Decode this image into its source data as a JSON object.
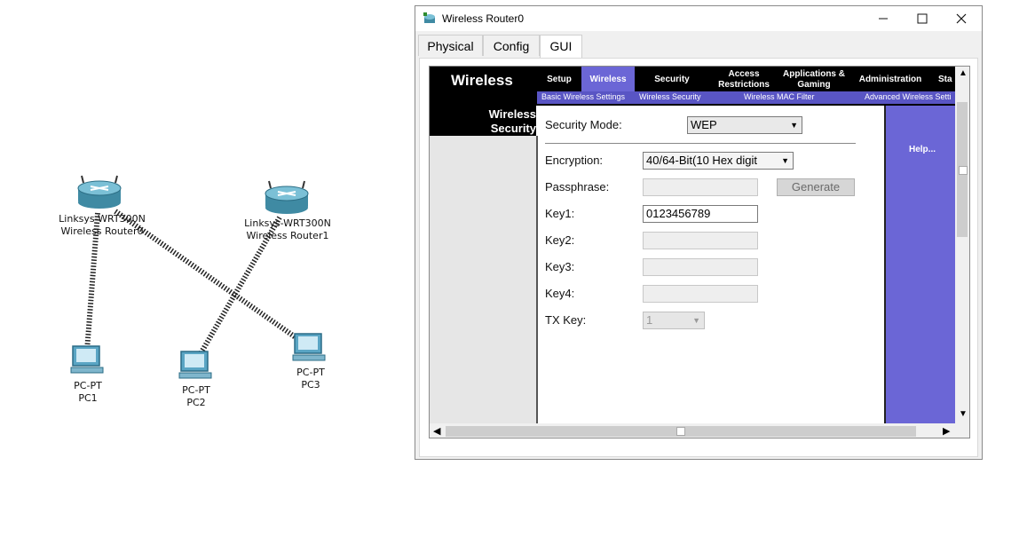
{
  "topology": {
    "routers": [
      {
        "model": "Linksys-WRT300N",
        "name": "Wireless Router0"
      },
      {
        "model": "Linksys-WRT300N",
        "name": "Wireless Router1"
      }
    ],
    "pcs": [
      {
        "model": "PC-PT",
        "name": "PC1"
      },
      {
        "model": "PC-PT",
        "name": "PC2"
      },
      {
        "model": "PC-PT",
        "name": "PC3"
      }
    ]
  },
  "window": {
    "title": "Wireless Router0",
    "tabs": [
      "Physical",
      "Config",
      "GUI"
    ],
    "active_tab": "GUI"
  },
  "router_gui": {
    "brand": "Wireless",
    "menu": [
      {
        "label": "Setup"
      },
      {
        "label": "Wireless",
        "active": true
      },
      {
        "label": "Security"
      },
      {
        "label": "Access Restrictions"
      },
      {
        "label": "Applications & Gaming"
      },
      {
        "label": "Administration"
      },
      {
        "label": "Sta"
      }
    ],
    "submenu": [
      "Basic Wireless Settings",
      "Wireless Security",
      "Wireless MAC Filter",
      "Advanced Wireless Setti"
    ],
    "section_title_line1": "Wireless",
    "section_title_line2": "Security",
    "help_label": "Help...",
    "security_mode_label": "Security Mode:",
    "security_mode_value": "WEP",
    "encryption_label": "Encryption:",
    "encryption_value": "40/64-Bit(10 Hex digit",
    "passphrase_label": "Passphrase:",
    "passphrase_value": "",
    "generate_label": "Generate",
    "key1_label": "Key1:",
    "key1_value": "0123456789",
    "key2_label": "Key2:",
    "key2_value": "",
    "key3_label": "Key3:",
    "key3_value": "",
    "key4_label": "Key4:",
    "key4_value": "",
    "txkey_label": "TX Key:",
    "txkey_value": "1"
  }
}
